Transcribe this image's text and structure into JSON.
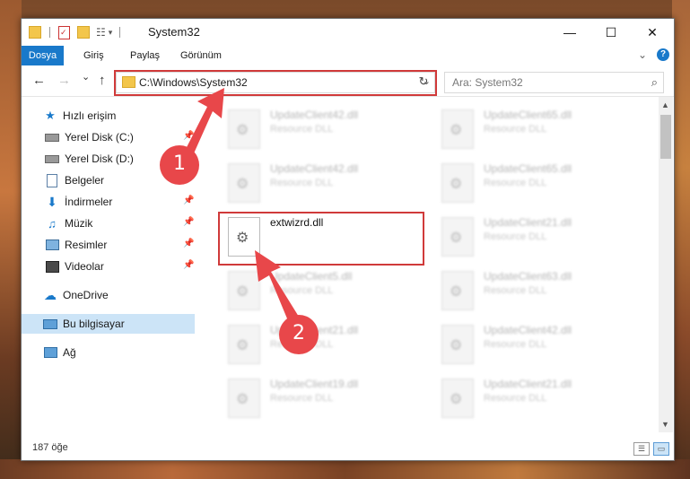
{
  "window": {
    "title": "System32",
    "minimize_glyph": "—",
    "maximize_glyph": "☐",
    "close_glyph": "✕"
  },
  "ribbon": {
    "tabs": [
      "Dosya",
      "Giriş",
      "Paylaş",
      "Görünüm"
    ],
    "active_tab": "Dosya",
    "expand_glyph": "⌄",
    "help_glyph": "?"
  },
  "navigation": {
    "back_glyph": "←",
    "forward_glyph": "→",
    "recent_glyph": "⌄",
    "up_glyph": "↑",
    "address": "C:\\Windows\\System32",
    "address_chevron": "⌄",
    "refresh_glyph": "↻",
    "search_placeholder": "Ara: System32",
    "search_glyph": "⌕"
  },
  "sidebar": {
    "items": [
      {
        "label": "Hızlı erişim",
        "icon": "star-icon"
      },
      {
        "label": "Yerel Disk (C:)",
        "icon": "drive-icon",
        "pinned": true
      },
      {
        "label": "Yerel Disk (D:)",
        "icon": "drive-icon",
        "pinned": true
      },
      {
        "label": "Belgeler",
        "icon": "documents-icon",
        "pinned": true
      },
      {
        "label": "İndirmeler",
        "icon": "download-icon",
        "pinned": true
      },
      {
        "label": "Müzik",
        "icon": "music-icon",
        "pinned": true
      },
      {
        "label": "Resimler",
        "icon": "pictures-icon",
        "pinned": true
      },
      {
        "label": "Videolar",
        "icon": "videos-icon",
        "pinned": true
      },
      {
        "label": "OneDrive",
        "icon": "cloud-icon"
      },
      {
        "label": "Bu bilgisayar",
        "icon": "computer-icon",
        "selected": true
      },
      {
        "label": "Ağ",
        "icon": "network-icon"
      }
    ]
  },
  "files": [
    {
      "name": "UpdateClient42.dll",
      "type": "Resource DLL"
    },
    {
      "name": "UpdateClient65.dll",
      "type": "Resource DLL"
    },
    {
      "name": "UpdateClient42.dll",
      "type": "Resource DLL"
    },
    {
      "name": "UpdateClient65.dll",
      "type": "Resource DLL"
    },
    {
      "name": "extwizrd.dll",
      "type": ""
    },
    {
      "name": "UpdateClient21.dll",
      "type": "Resource DLL"
    },
    {
      "name": "UpdateClient5.dll",
      "type": "Resource DLL"
    },
    {
      "name": "UpdateClient63.dll",
      "type": "Resource DLL"
    },
    {
      "name": "UpdateClient21.dll",
      "type": "Resource DLL"
    },
    {
      "name": "UpdateClient42.dll",
      "type": "Resource DLL"
    },
    {
      "name": "UpdateClient19.dll",
      "type": "Resource DLL"
    },
    {
      "name": "UpdateClient21.dll",
      "type": "Resource DLL"
    }
  ],
  "status": {
    "item_count": "187 öğe"
  },
  "annotations": {
    "step1": "1",
    "step2": "2",
    "arrow_color": "#e8474a",
    "highlight_color": "#d03a3a"
  },
  "colors": {
    "accent": "#1979ca",
    "selection": "#cce4f7"
  }
}
